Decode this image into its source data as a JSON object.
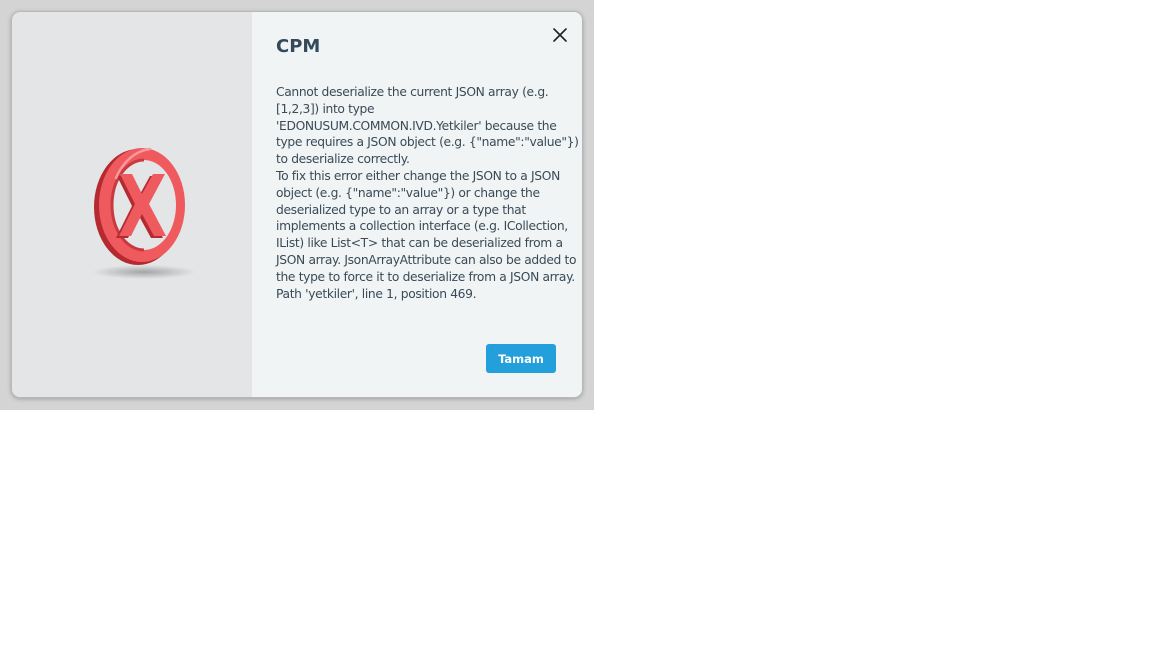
{
  "dialog": {
    "title": "CPM",
    "message_lines": [
      "Cannot deserialize the current JSON array (e.g. [1,2,3]) into type 'EDONUSUM.COMMON.IVD.Yetkiler' because the type requires a JSON object (e.g. {\"name\":\"value\"}) to deserialize correctly.",
      "To fix this error either change the JSON to a JSON object (e.g. {\"name\":\"value\"}) or change the deserialized type to an array or a type that implements a collection interface (e.g. ICollection, IList) like List<T> that can be deserialized from a JSON array. JsonArrayAttribute can also be added to the type to force it to deserialize from a JSON array.",
      "Path 'yetkiler', line 1, position 469."
    ],
    "ok_label": "Tamam",
    "close_icon": "close-icon",
    "error_icon": "error-x-circle-icon"
  },
  "colors": {
    "accent": "#239fdb",
    "title": "#34495a",
    "text": "#3a4a57",
    "side_panel": "#e3e5e6",
    "content_panel": "#f0f4f5",
    "backdrop": "#d4d4d4",
    "error_red": "#e5484d"
  }
}
